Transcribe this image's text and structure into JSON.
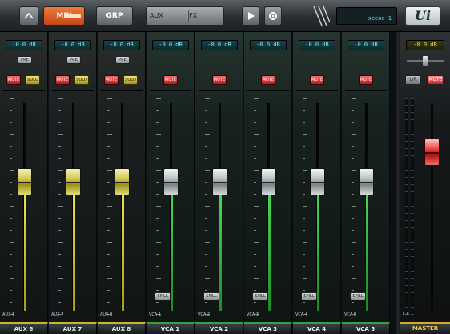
{
  "toolbar": {
    "mix_label": "MIX",
    "group_label": "GRP",
    "scene_a_label": "AUX",
    "scene_b_label": "FX",
    "display_text": "scene 1",
    "logo_text": "Ui"
  },
  "channels": [
    {
      "kind": "aux",
      "name": "AUX 6",
      "meter": "-0.0 dB",
      "pre_label": "PRE",
      "mute_label": "MUTE",
      "solo_label": "SOLO",
      "source": "AUX 6",
      "level": 0.62
    },
    {
      "kind": "aux",
      "name": "AUX 7",
      "meter": "-0.0 dB",
      "pre_label": "PRE",
      "mute_label": "MUTE",
      "solo_label": "SOLO",
      "source": "AUX 7",
      "level": 0.62
    },
    {
      "kind": "aux",
      "name": "AUX 8",
      "meter": "-0.0 dB",
      "pre_label": "PRE",
      "mute_label": "MUTE",
      "solo_label": "SOLO",
      "source": "AUX 8",
      "level": 0.62
    },
    {
      "kind": "vca",
      "name": "VCA 1",
      "meter": "-0.0 dB",
      "mute_label": "MUTE",
      "vca_tag": "SPILL",
      "source": "VCA 1",
      "level": 0.62
    },
    {
      "kind": "vca",
      "name": "VCA 2",
      "meter": "-0.0 dB",
      "mute_label": "MUTE",
      "vca_tag": "SPILL",
      "source": "VCA 2",
      "level": 0.62
    },
    {
      "kind": "vca",
      "name": "VCA 3",
      "meter": "-0.0 dB",
      "mute_label": "MUTE",
      "vca_tag": "SPILL",
      "source": "VCA 3",
      "level": 0.62
    },
    {
      "kind": "vca",
      "name": "VCA 4",
      "meter": "-0.0 dB",
      "mute_label": "MUTE",
      "vca_tag": "SPILL",
      "source": "VCA 4",
      "level": 0.62
    },
    {
      "kind": "vca",
      "name": "VCA 5",
      "meter": "-0.0 dB",
      "mute_label": "MUTE",
      "vca_tag": "SPILL",
      "source": "VCA 5",
      "level": 0.62
    }
  ],
  "master": {
    "name": "MASTER",
    "meter": "-0.0 dB",
    "btn_a_label": "L/R",
    "btn_b_label": "MUTE",
    "source": "L R",
    "level": 0.76
  },
  "colors": {
    "aux_accent": "#c9b823",
    "vca_accent": "#2fa53a",
    "master_accent": "#ee3b3b",
    "mix_button": "#f07a3a"
  }
}
